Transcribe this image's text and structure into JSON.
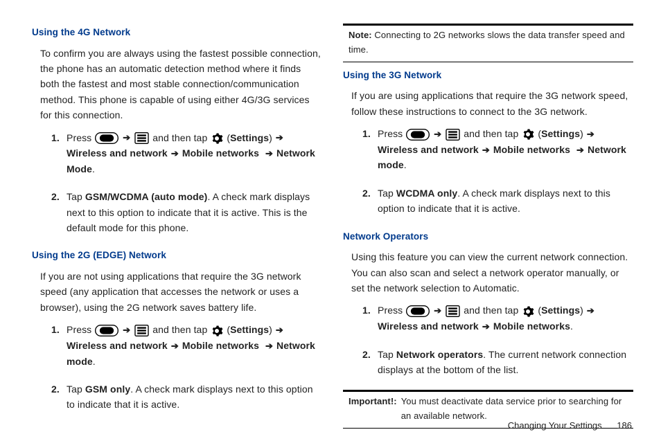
{
  "left": {
    "section4g": {
      "heading": "Using the 4G Network",
      "para": "To confirm you are always using the fastest possible connection, the phone has an automatic detection method where it finds both the fastest and most stable connection/communication method. This phone is capable of using either 4G/3G services for this connection.",
      "steps": {
        "s1": {
          "press": "Press ",
          "andthentap": " and then tap ",
          "settings_open": " (",
          "settings": "Settings",
          "settings_close": ") ",
          "wireless": "Wireless and network",
          "mobile": "Mobile networks",
          "netmode": "Network Mode",
          "dot": "."
        },
        "s2": {
          "tap": "Tap ",
          "bold": "GSM/WCDMA (auto mode)",
          "rest": ". A check mark displays next to this option to indicate that it is active. This is the default mode for this phone."
        }
      }
    },
    "section2g": {
      "heading": "Using the 2G (EDGE) Network",
      "para": "If you are not using applications that require the 3G network speed (any application that accesses the network or uses a browser), using the 2G network saves battery life.",
      "steps": {
        "s1": {
          "press": "Press ",
          "andthentap": " and then tap ",
          "settings_open": " (",
          "settings": "Settings",
          "settings_close": ") ",
          "wireless": "Wireless and network",
          "mobile": "Mobile networks",
          "netmode": "Network mode",
          "dot": "."
        },
        "s2": {
          "tap": "Tap ",
          "bold": "GSM only",
          "rest": ". A check mark displays next to this option to indicate that it is active."
        }
      }
    }
  },
  "right": {
    "note": {
      "label": "Note:",
      "text": " Connecting to 2G networks slows the data transfer speed and time."
    },
    "section3g": {
      "heading": "Using the 3G Network",
      "para": "If you are using applications that require the 3G network speed, follow these instructions to connect to the 3G network.",
      "steps": {
        "s1": {
          "press": "Press ",
          "andthentap": " and then tap ",
          "settings_open": " (",
          "settings": "Settings",
          "settings_close": ") ",
          "wireless": "Wireless and network",
          "mobile": "Mobile networks",
          "netmode": "Network mode",
          "dot": "."
        },
        "s2": {
          "tap": "Tap ",
          "bold": "WCDMA only",
          "rest": ". A check mark displays next to this option to indicate that it is active."
        }
      }
    },
    "netops": {
      "heading": "Network Operators",
      "para": "Using this feature you can view the current network connection. You can also scan and select a network operator manually, or set the network selection to Automatic.",
      "steps": {
        "s1": {
          "press": "Press ",
          "andthentap": " and then tap ",
          "settings_open": " (",
          "settings": "Settings",
          "settings_close": ") ",
          "wireless": "Wireless and network",
          "mobile": "Mobile networks",
          "dot": "."
        },
        "s2": {
          "tap": "Tap ",
          "bold": "Network operators",
          "rest": ". The current network connection displays at the bottom of the list."
        }
      }
    },
    "important": {
      "label": "Important!:",
      "text": "You must deactivate data service prior to searching for an available network."
    }
  },
  "footer": {
    "chapter": "Changing Your Settings",
    "page": "186"
  },
  "glyphs": {
    "arrow": "➔"
  }
}
